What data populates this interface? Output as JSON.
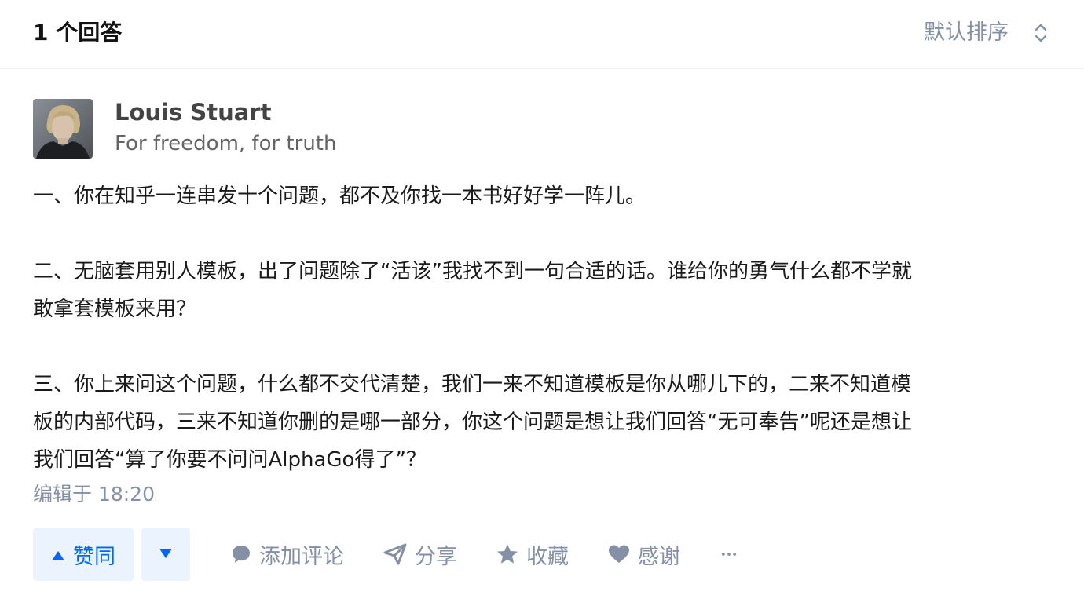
{
  "header": {
    "answer_count": "1 个回答",
    "sort_label": "默认排序",
    "sort_icon": "chevron-up-down-icon"
  },
  "author": {
    "avatar": "avatar",
    "name": "Louis Stuart",
    "bio": "For freedom, for truth"
  },
  "answer": {
    "paragraphs": [
      [
        "一、你在知乎一连串发十个问题，都不及你找一本书好好学一阵儿。"
      ],
      [
        "二、无脑套用别人模板，出了问题除了“活该”我找不到一句合适的话。谁给你的勇气什么都不学就",
        "敢拿套模板来用？"
      ],
      [
        "三、你上来问这个问题，什么都不交代清楚，我们一来不知道模板是你从哪儿下的，二来不知道模",
        "板的内部代码，三来不知道你删的是哪一部分，你这个问题是想让我们回答“无可奉告”呢还是想让",
        "我们回答“算了你要不问问AlphaGo得了”？"
      ]
    ],
    "edit_time": "编辑于 18:20"
  },
  "actions": {
    "vote_up_label": "赞同",
    "vote_up_icon": "triangle-up-icon",
    "vote_down_icon": "triangle-down-icon",
    "comment_label": "添加评论",
    "comment_icon": "comment-icon",
    "share_label": "分享",
    "share_icon": "paper-plane-icon",
    "collect_label": "收藏",
    "collect_icon": "star-icon",
    "thanks_label": "感谢",
    "thanks_icon": "heart-icon",
    "more_icon": "more-icon"
  },
  "colors": {
    "accent": "#0066ff",
    "vote_bg": "#eaf3fe",
    "meta": "#8590a6",
    "text": "#1a1a1a"
  }
}
